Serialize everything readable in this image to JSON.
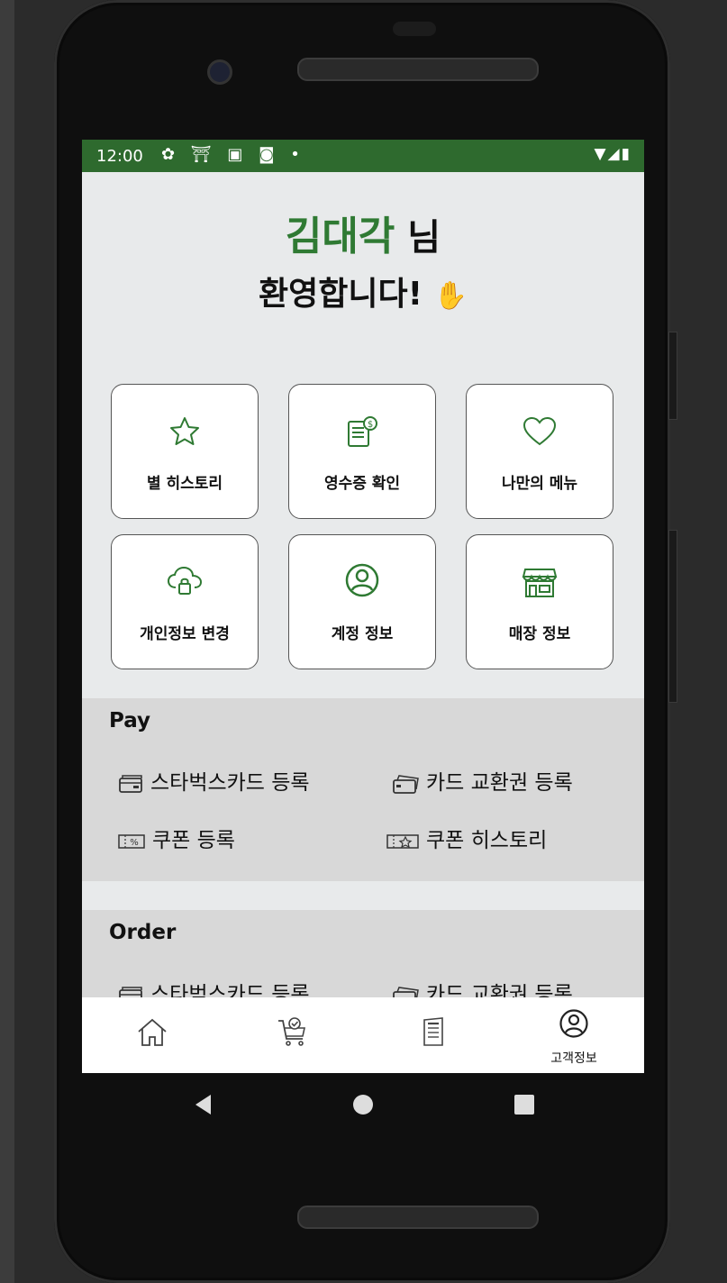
{
  "status_bar": {
    "time": "12:00",
    "left_icons": "✿ ⛩ ▣ ◙ •",
    "right_icons": "▼◢▮"
  },
  "greeting": {
    "name": "김대각",
    "honorific": " 님",
    "welcome": "환영합니다!",
    "emoji": "✋"
  },
  "tiles": [
    {
      "label": "별 히스토리",
      "icon": "star-icon"
    },
    {
      "label": "영수증 확인",
      "icon": "receipt-icon"
    },
    {
      "label": "나만의 메뉴",
      "icon": "heart-icon"
    },
    {
      "label": "개인정보 변경",
      "icon": "cloud-lock-icon"
    },
    {
      "label": "계정 정보",
      "icon": "account-icon"
    },
    {
      "label": "매장 정보",
      "icon": "store-icon"
    }
  ],
  "pay": {
    "title": "Pay",
    "items": [
      "스타벅스카드 등록",
      "카드 교환권 등록",
      "쿠폰 등록",
      "쿠폰 히스토리"
    ]
  },
  "order": {
    "title": "Order",
    "items": [
      "스타벅스카드 등록",
      "카드 교환권 등록"
    ]
  },
  "bottom_nav": [
    {
      "icon": "home-icon",
      "label": ""
    },
    {
      "icon": "cart-icon",
      "label": ""
    },
    {
      "icon": "menu-icon",
      "label": ""
    },
    {
      "icon": "customer-icon",
      "label": "고객정보"
    }
  ],
  "colors": {
    "accent": "#2f7a33",
    "status_bar": "#2e6a2e",
    "background": "#e8eaeb",
    "section": "#d8d8d8"
  }
}
